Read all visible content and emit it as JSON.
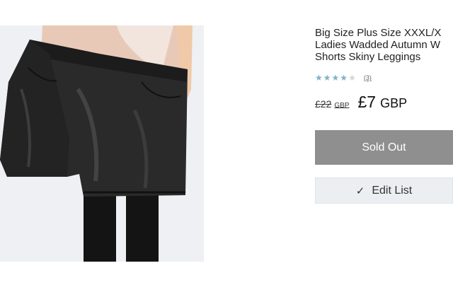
{
  "product": {
    "title_lines": [
      "Big Size Plus Size XXXL/X",
      "Ladies Wadded Autumn W",
      "Shorts Skiny Leggings"
    ],
    "rating_stars": 4,
    "rating_max": 5,
    "review_count": "(3)",
    "old_price": "£22",
    "old_price_unit": "GBP",
    "price": "£7",
    "currency": "GBP"
  },
  "buttons": {
    "sold_out": "Sold Out",
    "edit_list": "Edit List",
    "edit_list_icon": "✓"
  },
  "icons": {
    "rating": "star-icon",
    "edit": "checkmark-icon"
  },
  "colors": {
    "sold_out_bg": "#8f8f8f",
    "star_on": "#7fb2c9",
    "edit_bg": "#eceff1"
  }
}
